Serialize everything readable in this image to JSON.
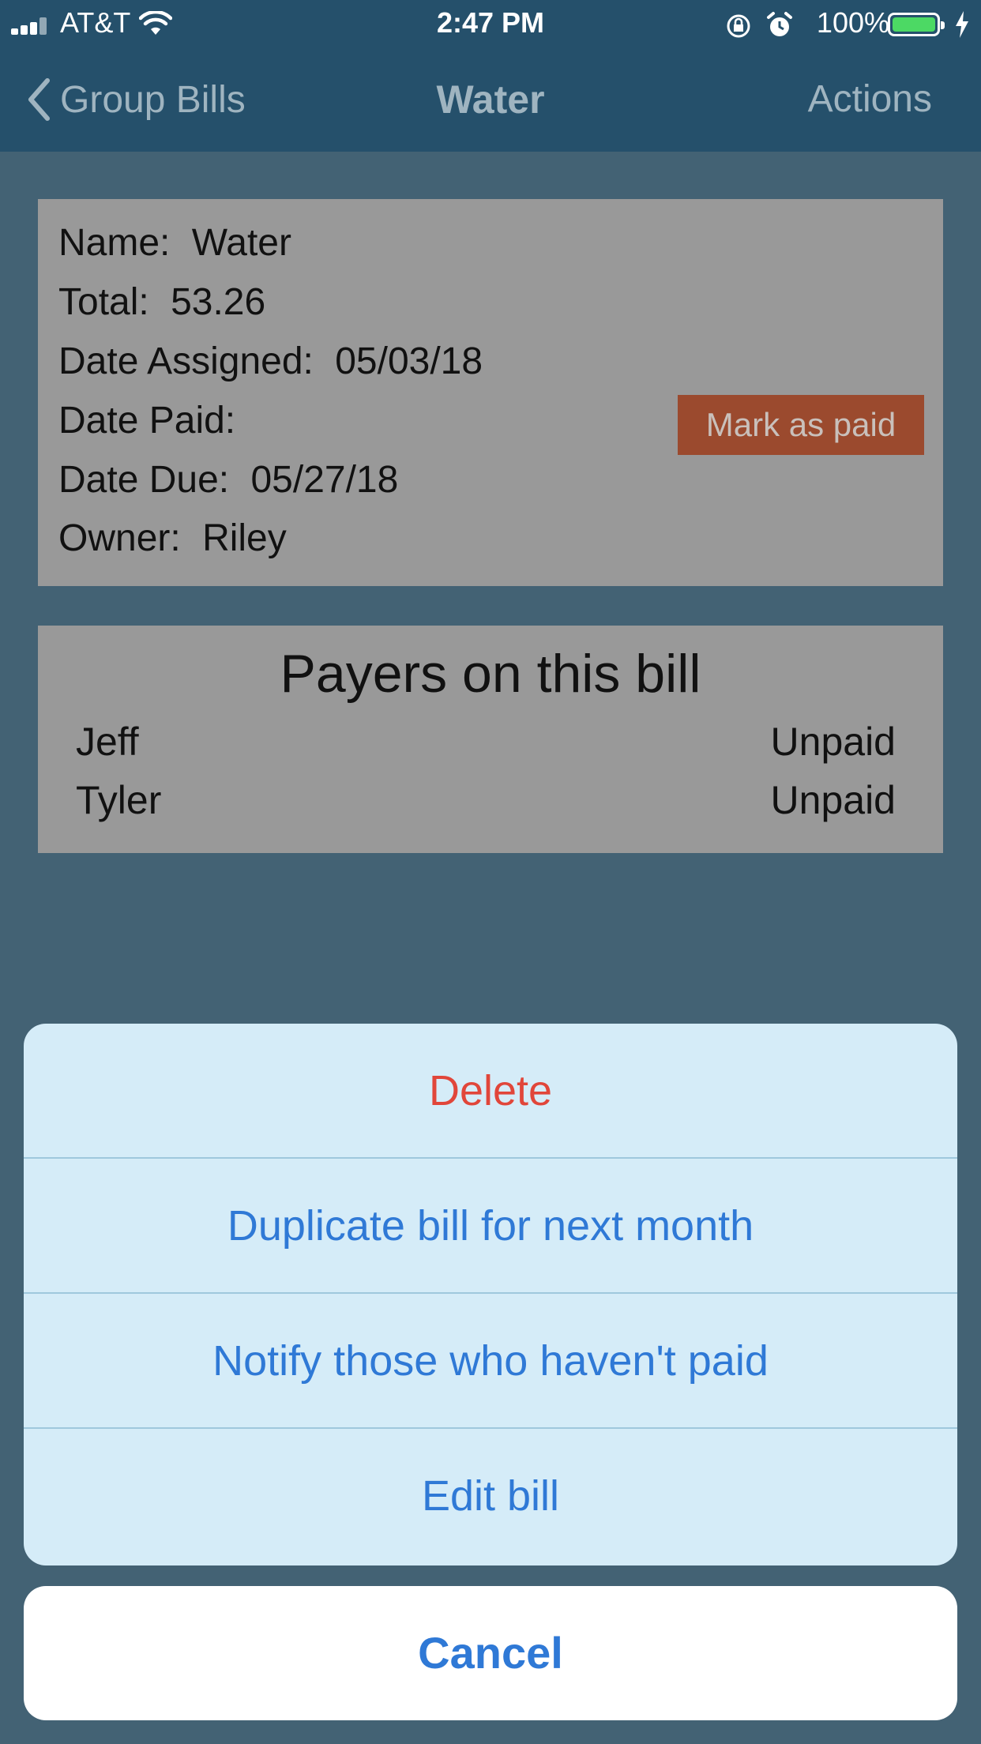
{
  "status_bar": {
    "carrier": "AT&T",
    "time": "2:47 PM",
    "battery": "100%",
    "battery_level": 1.0
  },
  "nav": {
    "back_label": "Group Bills",
    "title": "Water",
    "action_label": "Actions"
  },
  "bill": {
    "name_label": "Name:",
    "name": "Water",
    "total_label": "Total:",
    "total": "53.26",
    "date_assigned_label": "Date Assigned:",
    "date_assigned": "05/03/18",
    "date_paid_label": "Date Paid:",
    "date_paid": "",
    "date_due_label": "Date Due:",
    "date_due": "05/27/18",
    "owner_label": "Owner:",
    "owner": "Riley",
    "mark_paid_label": "Mark as paid"
  },
  "payers": {
    "title": "Payers on this bill",
    "list": [
      {
        "name": "Jeff",
        "status": "Unpaid"
      },
      {
        "name": "Tyler",
        "status": "Unpaid"
      }
    ]
  },
  "action_sheet": {
    "actions": [
      {
        "label": "Delete"
      },
      {
        "label": "Duplicate bill for next month"
      },
      {
        "label": "Notify those who haven't paid"
      },
      {
        "label": "Edit bill"
      }
    ],
    "cancel_label": "Cancel"
  },
  "colors": {
    "nav_bg": "#25506b",
    "card_bg": "#999999",
    "mark_paid_bg": "#9b4a2e",
    "sheet_bg": "#d5ecf8",
    "action_blue": "#2f79d6",
    "destructive_red": "#e1463a"
  }
}
